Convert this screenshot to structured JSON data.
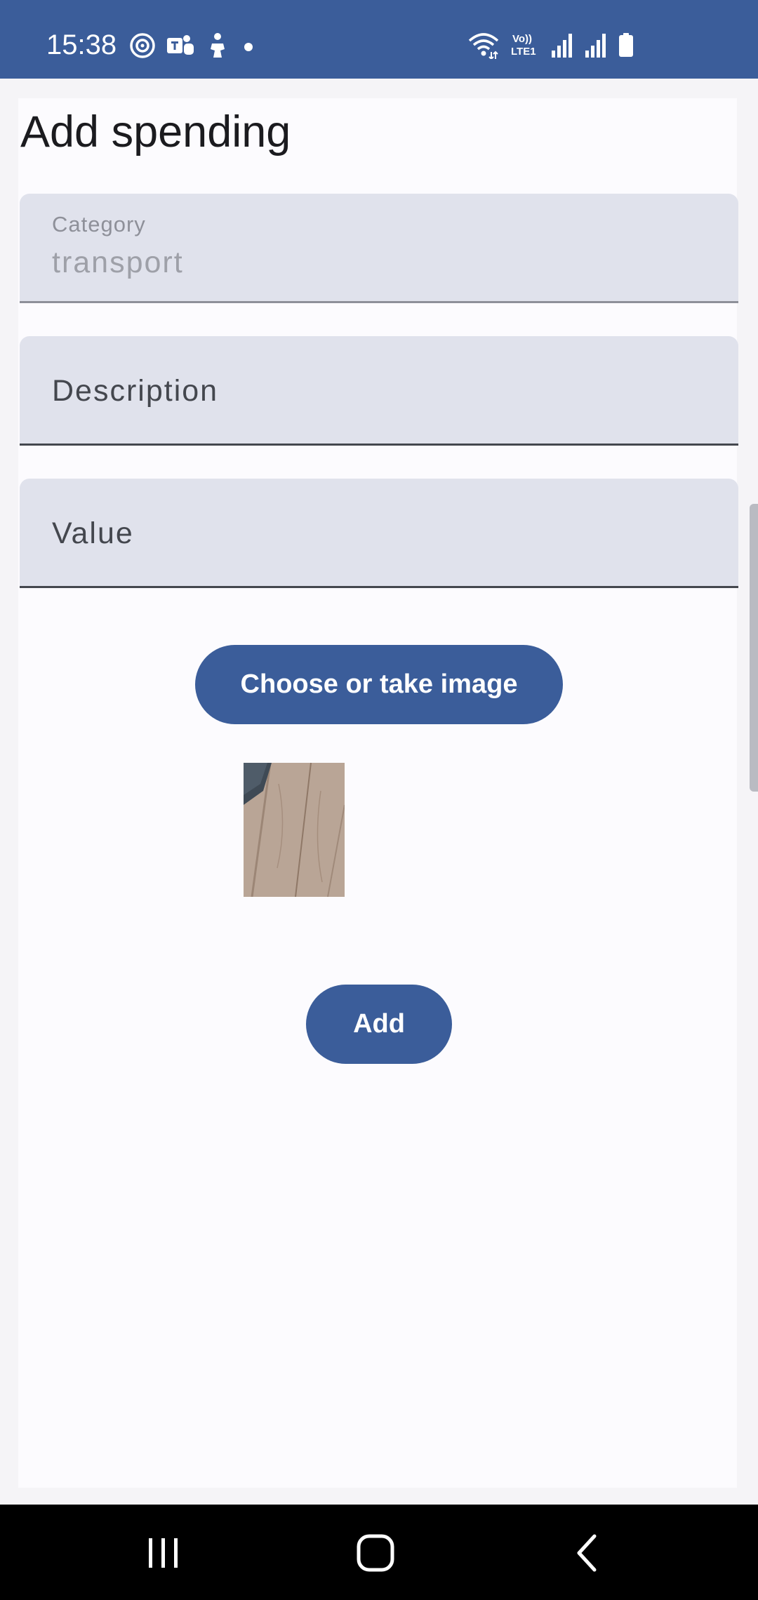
{
  "status_bar": {
    "time": "15:38",
    "left_icons": [
      "threads-icon",
      "teams-icon",
      "figure-icon",
      "dot-icon"
    ],
    "right_icons": [
      "wifi-icon",
      "volte-icon",
      "signal-icon",
      "signal-icon",
      "battery-icon"
    ],
    "volte_label_top": "Vo))",
    "volte_label_bottom": "LTE1"
  },
  "page": {
    "title": "Add spending"
  },
  "form": {
    "category": {
      "label": "Category",
      "value": "transport"
    },
    "description": {
      "label": "Description"
    },
    "value": {
      "label": "Value"
    },
    "choose_image_label": "Choose or take image",
    "add_label": "Add"
  },
  "nav_bar": {
    "buttons": [
      "recents-icon",
      "home-icon",
      "back-icon"
    ]
  },
  "colors": {
    "primary": "#3b5d9a",
    "field_background": "#e0e2ec",
    "page_background": "#fcfbfe"
  }
}
